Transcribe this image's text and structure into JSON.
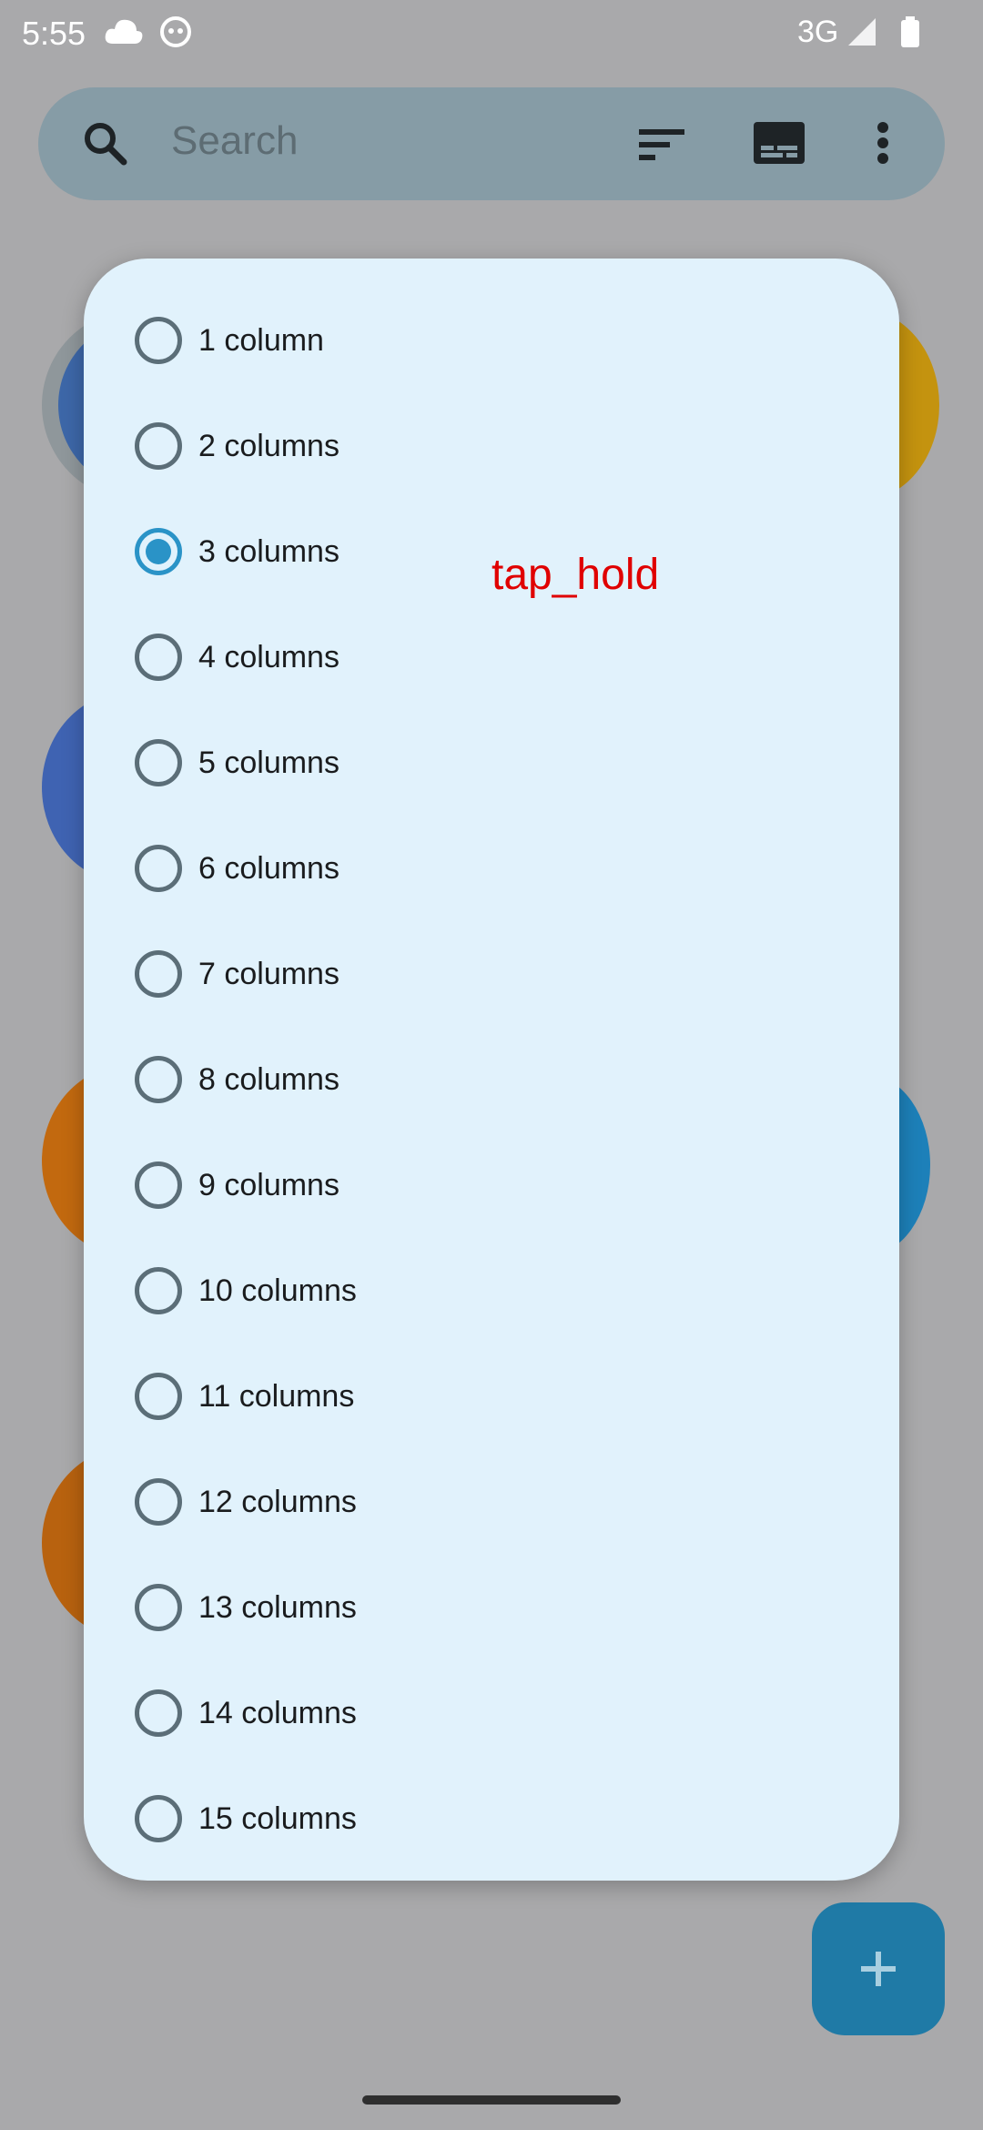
{
  "status_bar": {
    "time": "5:55",
    "network": "3G"
  },
  "search": {
    "placeholder": "Search"
  },
  "dialog": {
    "options": [
      {
        "label": "1 column",
        "selected": false
      },
      {
        "label": "2 columns",
        "selected": false
      },
      {
        "label": "3 columns",
        "selected": true
      },
      {
        "label": "4 columns",
        "selected": false
      },
      {
        "label": "5 columns",
        "selected": false
      },
      {
        "label": "6 columns",
        "selected": false
      },
      {
        "label": "7 columns",
        "selected": false
      },
      {
        "label": "8 columns",
        "selected": false
      },
      {
        "label": "9 columns",
        "selected": false
      },
      {
        "label": "10 columns",
        "selected": false
      },
      {
        "label": "11 columns",
        "selected": false
      },
      {
        "label": "12 columns",
        "selected": false
      },
      {
        "label": "13 columns",
        "selected": false
      },
      {
        "label": "14 columns",
        "selected": false
      },
      {
        "label": "15 columns",
        "selected": false
      }
    ]
  },
  "overlay": {
    "action_label": "tap_hold"
  },
  "colors": {
    "accent": "#2a93c7",
    "dialog_bg": "#e1f2fc",
    "overlay_text": "#e00000"
  },
  "icons": {
    "search": "search-icon",
    "sort": "sort-icon",
    "view": "view-mode-icon",
    "more": "more-vert-icon",
    "add": "add-icon"
  }
}
